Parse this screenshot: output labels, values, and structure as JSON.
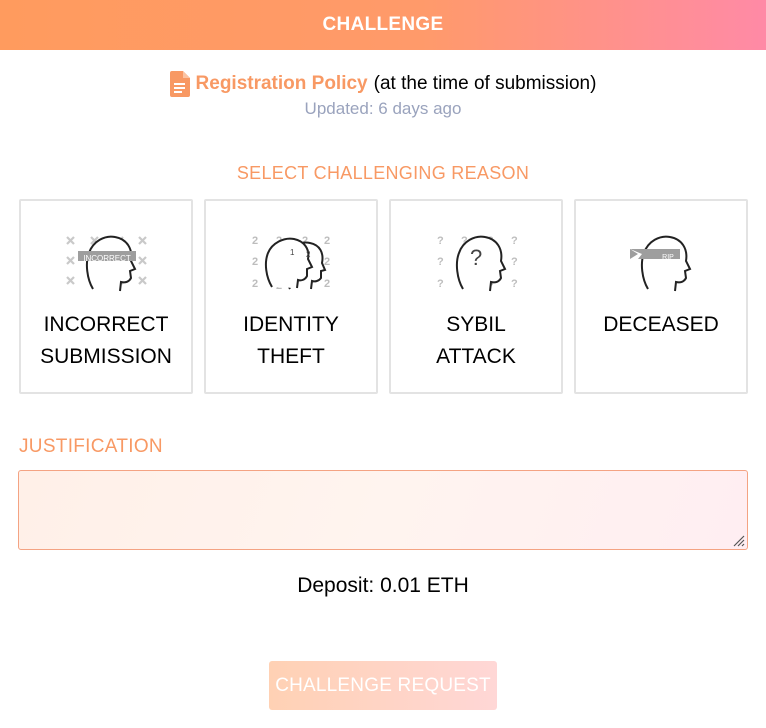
{
  "header": {
    "title": "CHALLENGE"
  },
  "policy": {
    "link_label": "Registration Policy",
    "suffix": "(at the time of submission)",
    "updated": "Updated: 6 days ago"
  },
  "reasons": {
    "title": "SELECT CHALLENGING REASON",
    "items": [
      {
        "line1": "INCORRECT",
        "line2": "SUBMISSION",
        "icon": "incorrect-submission-icon",
        "badge": "INCORRECT"
      },
      {
        "line1": "IDENTITY",
        "line2": "THEFT",
        "icon": "identity-theft-icon",
        "badge": ""
      },
      {
        "line1": "SYBIL",
        "line2": "ATTACK",
        "icon": "sybil-attack-icon",
        "badge": ""
      },
      {
        "line1": "DECEASED",
        "line2": "",
        "icon": "deceased-icon",
        "badge": "RIP"
      }
    ]
  },
  "justification": {
    "label": "JUSTIFICATION",
    "value": "",
    "placeholder": ""
  },
  "deposit": "Deposit: 0.01 ETH",
  "submit": {
    "label": "CHALLENGE REQUEST"
  },
  "colors": {
    "accent": "#f89964",
    "header_start": "#ff9b5e",
    "header_end": "#ff8aa6",
    "muted": "#9aa3bd"
  }
}
